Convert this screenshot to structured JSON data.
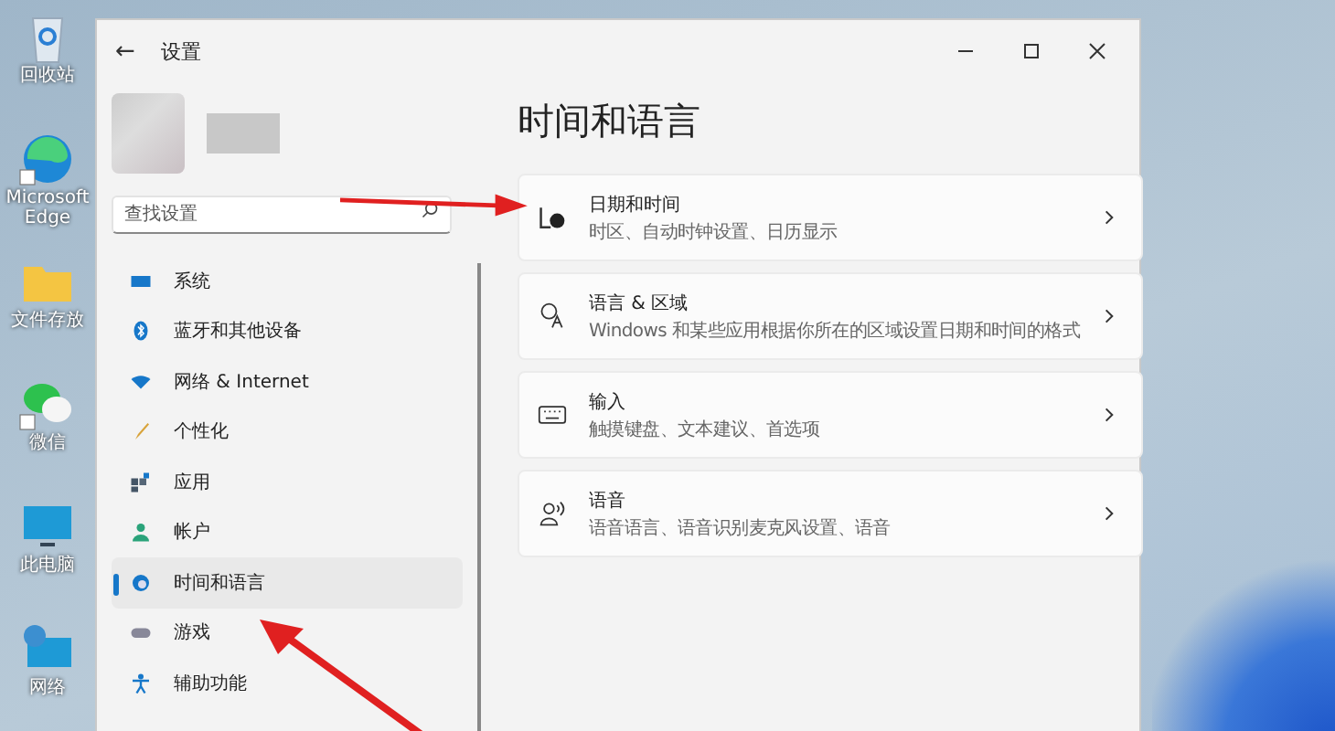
{
  "desktop": {
    "icons": [
      {
        "kind": "recycle",
        "label": "回收站",
        "shortcut": false
      },
      {
        "kind": "edge",
        "label": "Microsoft Edge",
        "shortcut": true
      },
      {
        "kind": "folder",
        "label": "文件存放",
        "shortcut": false
      },
      {
        "kind": "chat",
        "label": "微信",
        "shortcut": true
      },
      {
        "kind": "pc",
        "label": "此电脑",
        "shortcut": false
      },
      {
        "kind": "network",
        "label": "网络",
        "shortcut": false
      }
    ]
  },
  "window": {
    "title": "设置",
    "back": "←",
    "search": {
      "placeholder": "查找设置"
    },
    "nav": [
      {
        "kind": "system",
        "label": "系统",
        "selected": false
      },
      {
        "kind": "bluetooth",
        "label": "蓝牙和其他设备",
        "selected": false
      },
      {
        "kind": "network",
        "label": "网络 & Internet",
        "selected": false
      },
      {
        "kind": "brush",
        "label": "个性化",
        "selected": false
      },
      {
        "kind": "apps",
        "label": "应用",
        "selected": false
      },
      {
        "kind": "account",
        "label": "帐户",
        "selected": false
      },
      {
        "kind": "globe",
        "label": "时间和语言",
        "selected": true
      },
      {
        "kind": "game",
        "label": "游戏",
        "selected": false
      },
      {
        "kind": "access",
        "label": "辅助功能",
        "selected": false
      }
    ],
    "page_title": "时间和语言",
    "cards": [
      {
        "kind": "clock",
        "title": "日期和时间",
        "subtitle": "时区、自动时钟设置、日历显示"
      },
      {
        "kind": "language",
        "title": "语言 & 区域",
        "subtitle": "Windows 和某些应用根据你所在的区域设置日期和时间的格式"
      },
      {
        "kind": "keyboard",
        "title": "输入",
        "subtitle": "触摸键盘、文本建议、首选项"
      },
      {
        "kind": "speech",
        "title": "语音",
        "subtitle": "语音语言、语音识别麦克风设置、语音"
      }
    ]
  }
}
